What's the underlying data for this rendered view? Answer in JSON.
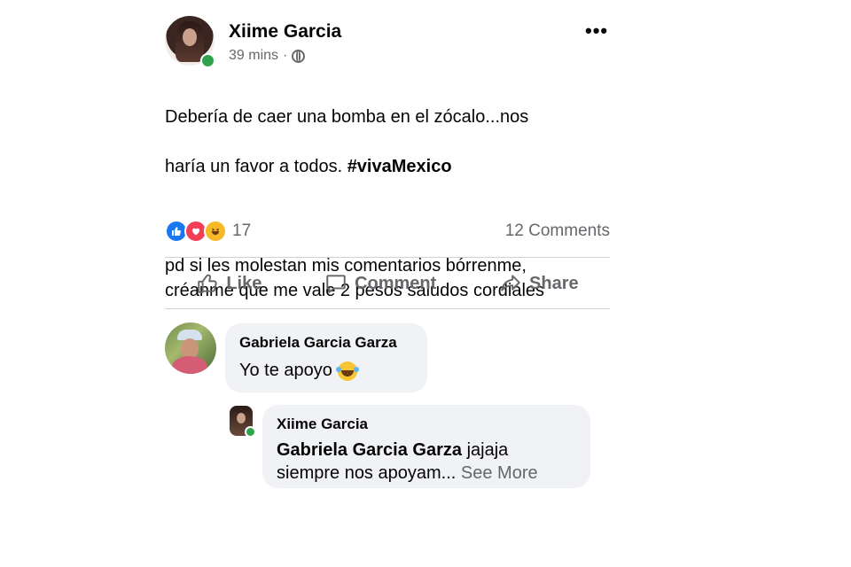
{
  "post": {
    "author": "Xiime Garcia",
    "time": "39 mins",
    "separator": "·",
    "text_line1": "Debería de caer una bomba en el zócalo...nos",
    "text_line2_prefix": "haría un favor a todos. ",
    "hashtag": "#vivaMexico",
    "text_para2": "pd si les molestan mis comentarios bórrenme,\ncréanme que me vale 2 pesos  saludos cordiales",
    "reactions_count": "17",
    "comments_count": "12 Comments",
    "more_icon": "•••"
  },
  "actions": {
    "like": "Like",
    "comment": "Comment",
    "share": "Share"
  },
  "comments": [
    {
      "author": "Gabriela Garcia Garza",
      "text": "Yo te apoyo"
    },
    {
      "author": "Xiime Garcia",
      "mention": "Gabriela Garcia Garza",
      "text_after_mention": " jajaja",
      "text_line2": "siempre nos apoyam...",
      "see_more": "See More"
    }
  ],
  "colors": {
    "like": "#1877f2",
    "love": "#f33e58",
    "haha": "#f7b928",
    "online": "#31a24c",
    "secondary_text": "#65676b",
    "bubble": "#f0f2f5"
  }
}
